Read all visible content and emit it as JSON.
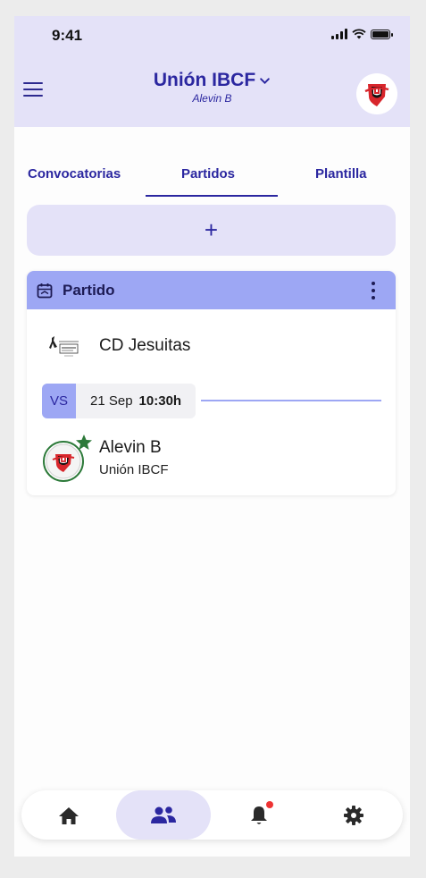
{
  "status_bar": {
    "time": "9:41"
  },
  "header": {
    "team_name": "Unión IBCF",
    "team_subtitle": "Alevin B"
  },
  "tabs": [
    {
      "label": "Convocatorias",
      "active": false
    },
    {
      "label": "Partidos",
      "active": true
    },
    {
      "label": "Plantilla",
      "active": false
    }
  ],
  "add_button": {
    "label": "+"
  },
  "match_card": {
    "title": "Partido",
    "opponent": {
      "name": "CD Jesuitas"
    },
    "vs_label": "VS",
    "date": "21 Sep",
    "time": "10:30h",
    "home": {
      "team": "Alevin B",
      "club": "Unión IBCF"
    }
  },
  "bottom_nav": {
    "items": [
      {
        "icon": "home-icon",
        "active": false
      },
      {
        "icon": "team-icon",
        "active": true
      },
      {
        "icon": "bell-icon",
        "active": false,
        "notification": true
      },
      {
        "icon": "gear-icon",
        "active": false
      }
    ]
  },
  "colors": {
    "header_bg": "#e4e2f8",
    "accent": "#2b27a0",
    "card_header": "#9da7f4",
    "logo_red": "#d8262c",
    "star_green": "#2d7a3a",
    "notification": "#e33333"
  }
}
